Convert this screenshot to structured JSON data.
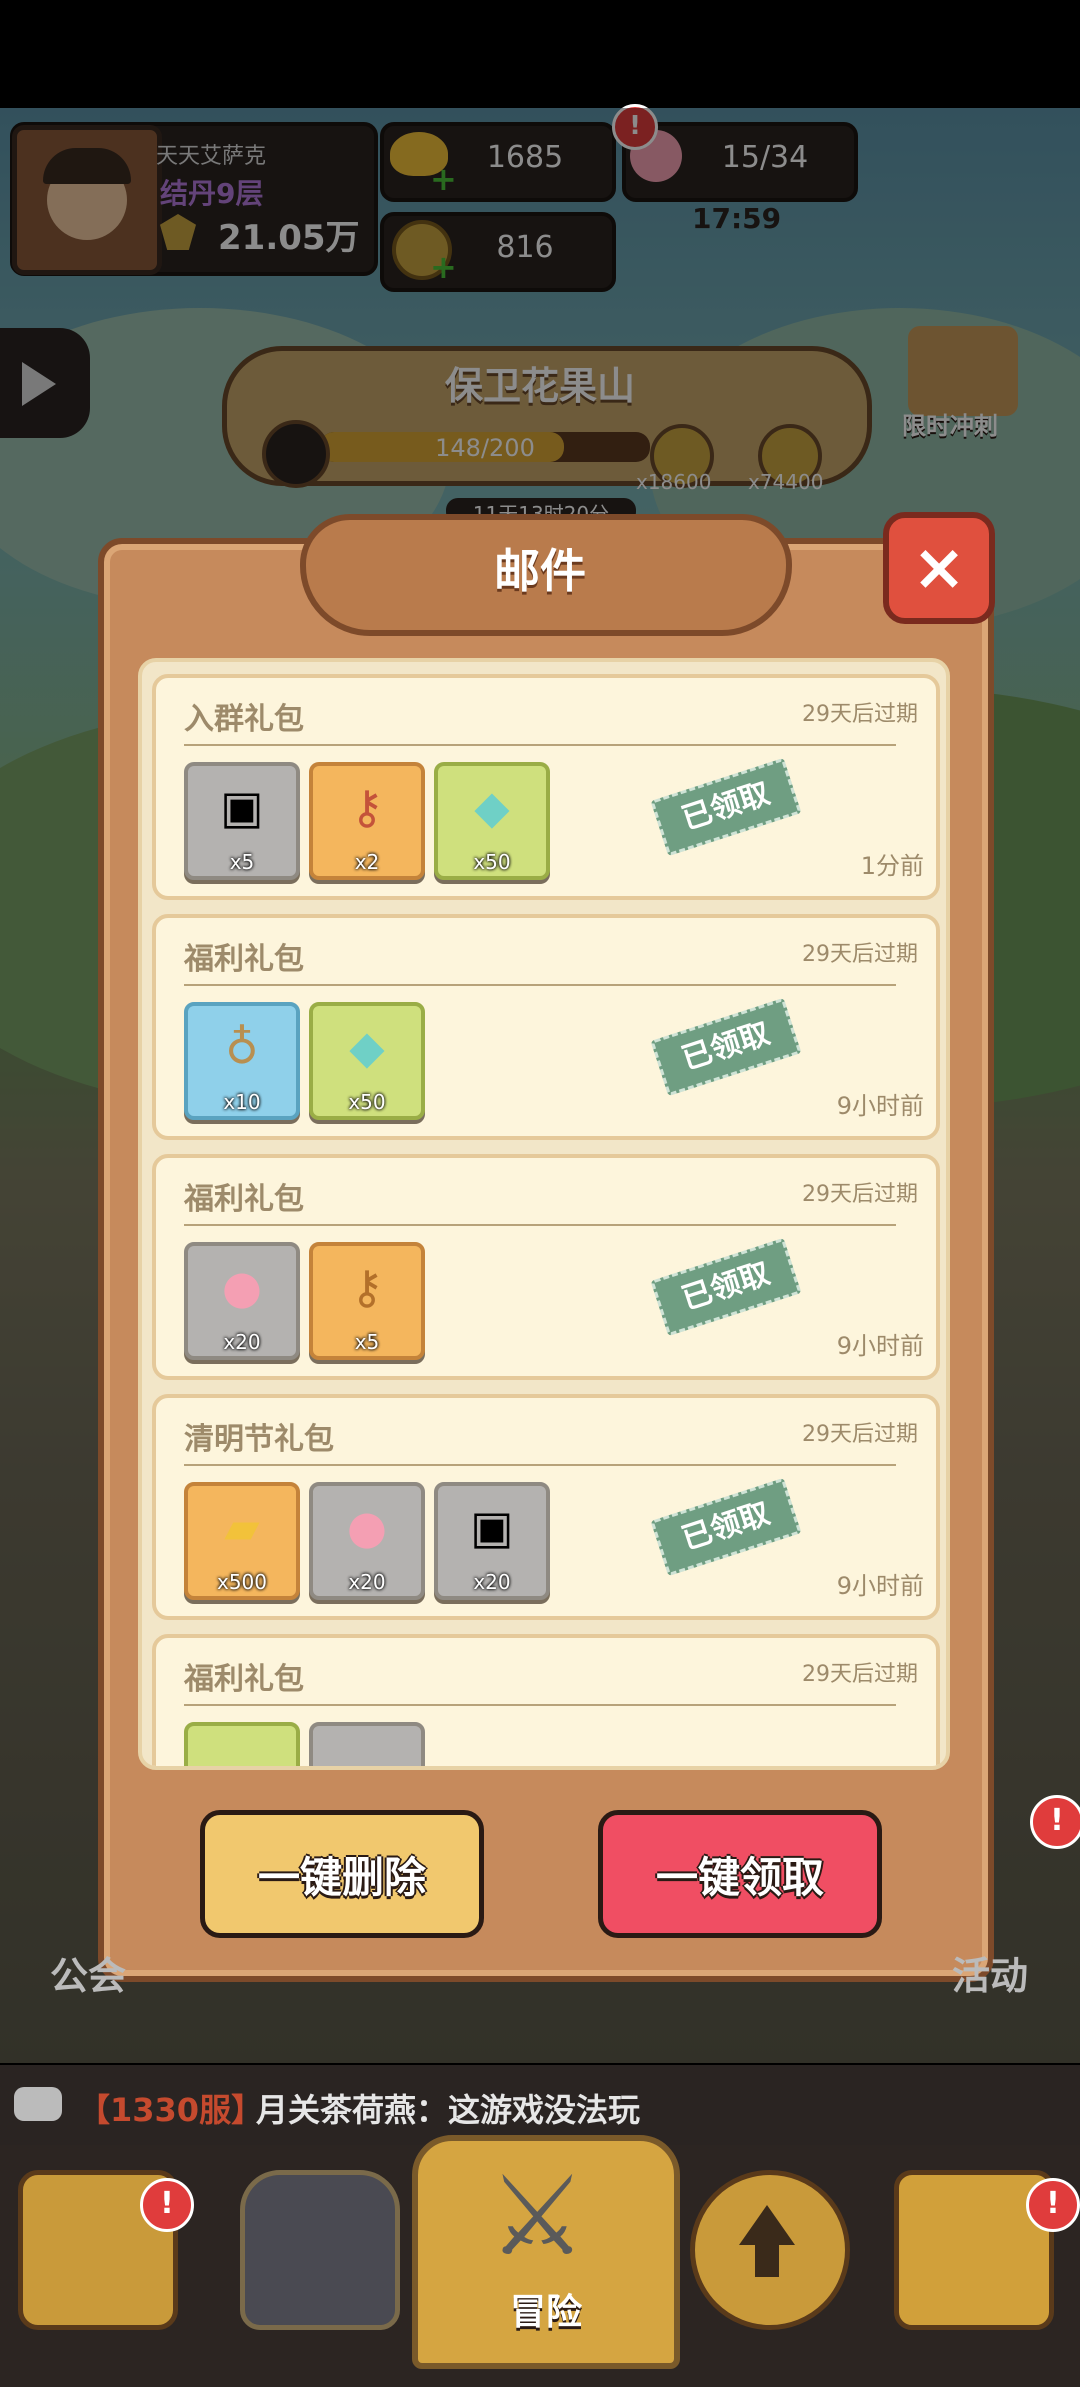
{
  "player": {
    "name": "天天艾萨克",
    "rank": "结丹9层",
    "power": "21.05万"
  },
  "resources": {
    "gold_ingot": "1685",
    "coin": "816",
    "peach": "15/34",
    "peach_timer": "17:59"
  },
  "event": {
    "title": "保卫花果山",
    "progress": "148/200",
    "progress_fraction": 0.74,
    "reward1": "x18600",
    "reward2": "x74400",
    "timer_partial": "11天13时20分"
  },
  "side_buttons": {
    "limited_sprint": "限时冲刺"
  },
  "dialog": {
    "title": "邮件",
    "close": "×",
    "delete_all": "一键删除",
    "claim_all": "一键领取"
  },
  "mails": [
    {
      "title": "入群礼包",
      "expire": "29天后过期",
      "time": "1分前",
      "stamp": "已领取",
      "items": [
        {
          "icon": "chest-icon",
          "qty": "x5",
          "color": "gray"
        },
        {
          "icon": "key-icon",
          "qty": "x2",
          "color": "orange"
        },
        {
          "icon": "crystal-icon",
          "qty": "x50",
          "color": "green"
        }
      ]
    },
    {
      "title": "福利礼包",
      "expire": "29天后过期",
      "time": "9小时前",
      "stamp": "已领取",
      "items": [
        {
          "icon": "gourd-icon",
          "qty": "x10",
          "color": "blue"
        },
        {
          "icon": "crystal-icon",
          "qty": "x50",
          "color": "green"
        }
      ]
    },
    {
      "title": "福利礼包",
      "expire": "29天后过期",
      "time": "9小时前",
      "stamp": "已领取",
      "items": [
        {
          "icon": "peach-icon",
          "qty": "x20",
          "color": "gray"
        },
        {
          "icon": "key-icon",
          "qty": "x5",
          "color": "orange"
        }
      ]
    },
    {
      "title": "清明节礼包",
      "expire": "29天后过期",
      "time": "9小时前",
      "stamp": "已领取",
      "items": [
        {
          "icon": "gold-ingot-icon",
          "qty": "x500",
          "color": "orange"
        },
        {
          "icon": "peach-icon",
          "qty": "x20",
          "color": "gray"
        },
        {
          "icon": "chest-icon",
          "qty": "x20",
          "color": "gray"
        }
      ]
    },
    {
      "title": "福利礼包",
      "expire": "29天后过期"
    }
  ],
  "bottom_labels": {
    "guild": "公会",
    "activity": "活动"
  },
  "chat": {
    "server": "【1330服】",
    "message": "月关茶荷燕：这游戏没法玩"
  },
  "nav": {
    "adventure": "冒险"
  },
  "colors": {
    "dialog_bg": "#c68a5c",
    "delete_button": "#f1c86e",
    "claim_button": "#f04e63",
    "stamp": "#6f9e82"
  }
}
